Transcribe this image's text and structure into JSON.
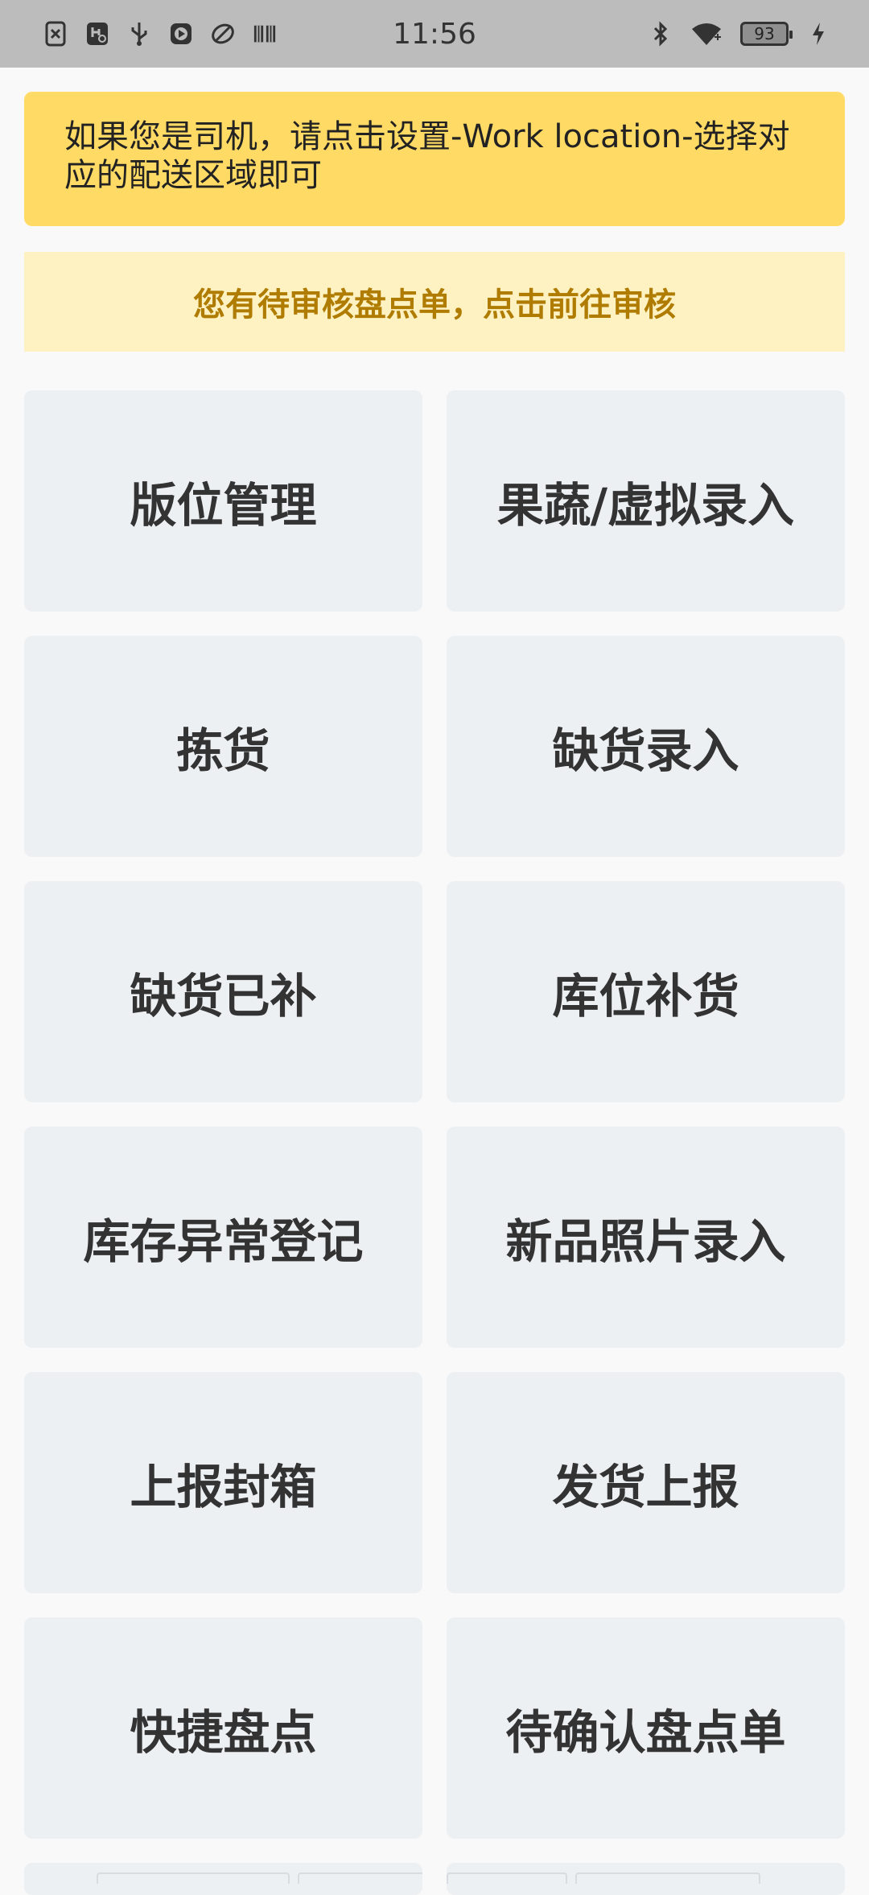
{
  "status_bar": {
    "time": "11:56",
    "battery": "93",
    "left_icons": [
      "sim-x-icon",
      "usb-settings-icon",
      "usb-icon",
      "play-icon",
      "link-icon",
      "book-icon"
    ],
    "right_icons": [
      "bluetooth-icon",
      "wifi-icon",
      "battery-icon",
      "charging-icon"
    ]
  },
  "notice": {
    "driver_tip": "如果您是司机，请点击设置-Work location-选择对应的配送区域即可",
    "pending_audit": "您有待审核盘点单，点击前往审核"
  },
  "menu": {
    "items": [
      {
        "label": "版位管理"
      },
      {
        "label": "果蔬/虚拟录入"
      },
      {
        "label": "拣货"
      },
      {
        "label": "缺货录入"
      },
      {
        "label": "缺货已补"
      },
      {
        "label": "库位补货"
      },
      {
        "label": "库存异常登记"
      },
      {
        "label": "新品照片录入"
      },
      {
        "label": "上报封箱"
      },
      {
        "label": "发货上报"
      },
      {
        "label": "快捷盘点"
      },
      {
        "label": "待确认盘点单"
      }
    ]
  },
  "colors": {
    "status_bar_bg": "#bcbcbc",
    "notice_yellow": "#ffdb66",
    "notice_pale": "#fff2c2",
    "notice_pale_text": "#b07c00",
    "tile_bg": "#edf0f3"
  }
}
